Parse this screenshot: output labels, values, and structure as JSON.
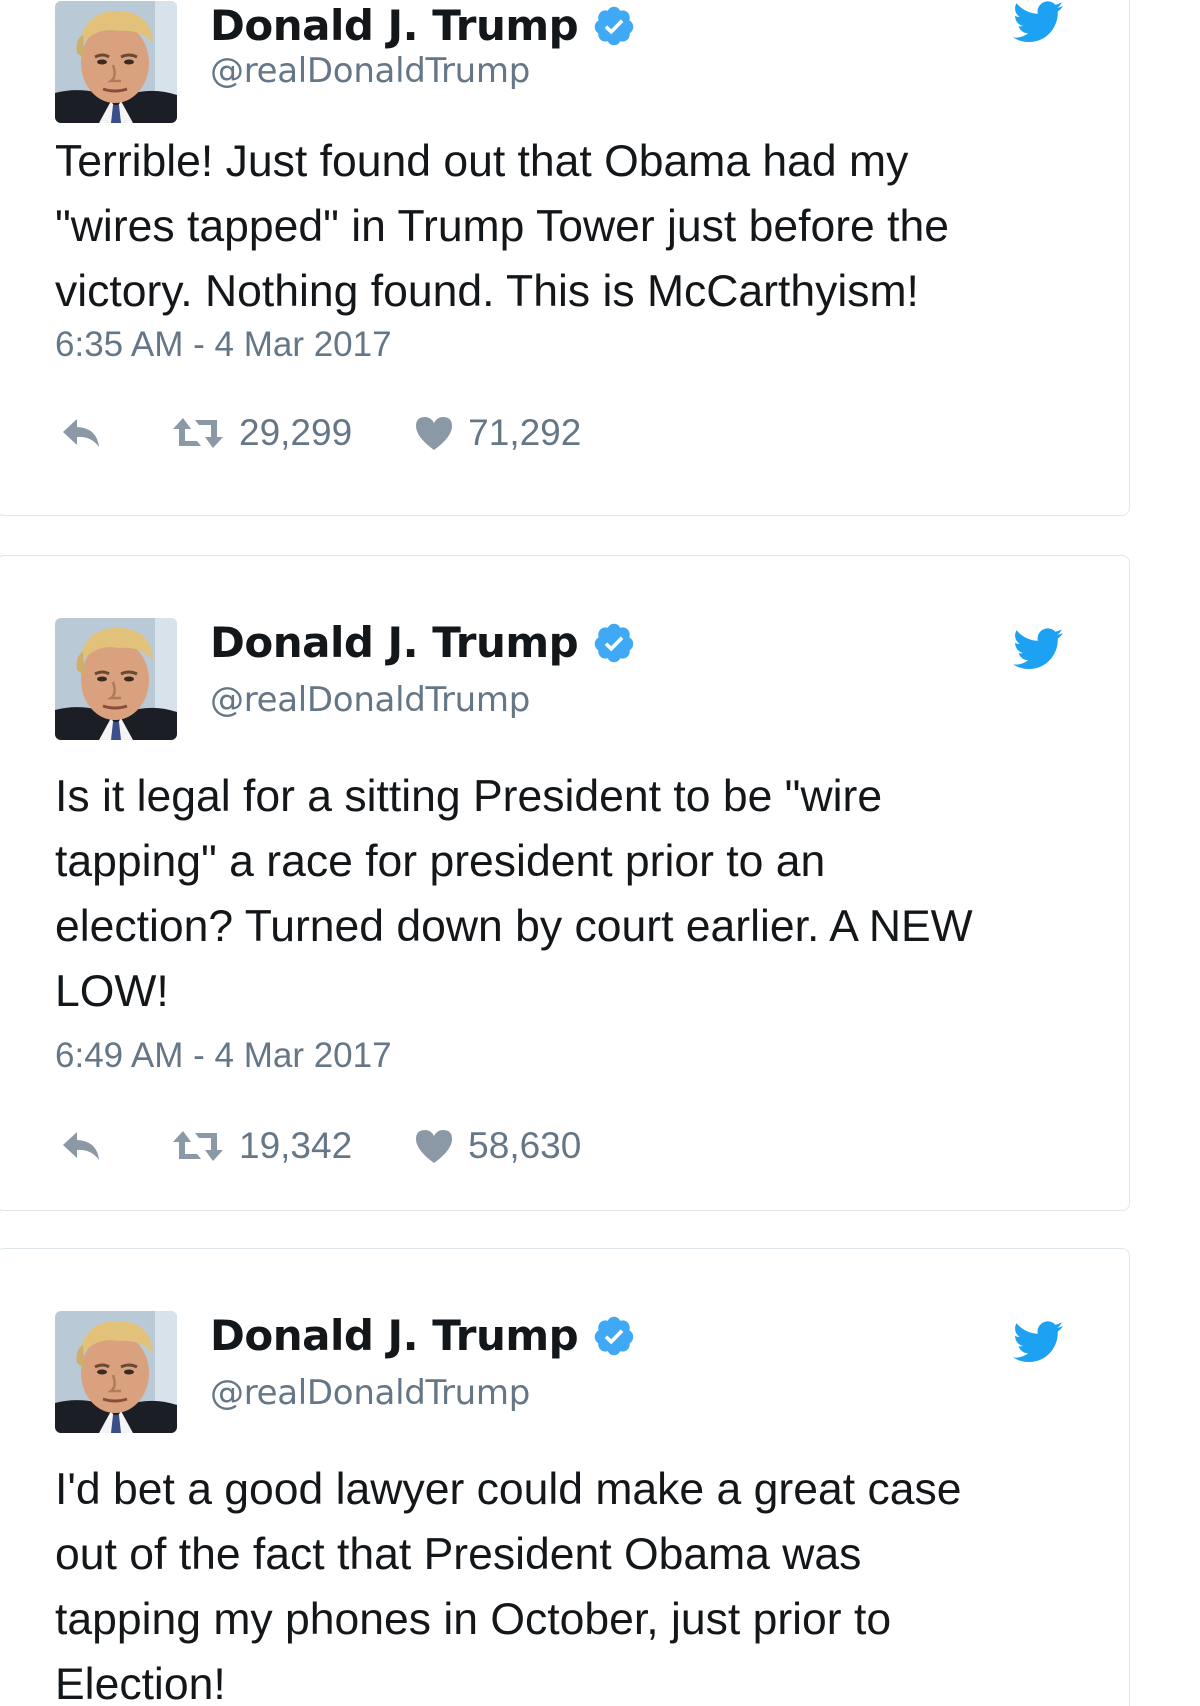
{
  "tweets": [
    {
      "name": "Donald J. Trump",
      "handle": "@realDonaldTrump",
      "text": "Terrible! Just found out that Obama had my\n\"wires tapped\" in Trump Tower just before the\nvictory. Nothing found. This is McCarthyism!",
      "timestamp": "6:35 AM - 4 Mar 2017",
      "retweets": "29,299",
      "likes": "71,292"
    },
    {
      "name": "Donald J. Trump",
      "handle": "@realDonaldTrump",
      "text": "Is it legal for a sitting President to be \"wire\ntapping\" a race for president prior to an\nelection? Turned down by court earlier. A NEW\nLOW!",
      "timestamp": "6:49 AM - 4 Mar 2017",
      "retweets": "19,342",
      "likes": "58,630"
    },
    {
      "name": "Donald J. Trump",
      "handle": "@realDonaldTrump",
      "text": "I'd bet a good lawyer could make a great case\nout of the fact that President Obama was\ntapping my phones in October, just prior to\nElection!"
    }
  ],
  "icons": {
    "verified": "verified-badge-icon",
    "twitter": "twitter-bird-icon",
    "reply": "reply-icon",
    "retweet": "retweet-icon",
    "like": "heart-icon"
  },
  "colors": {
    "twitter_blue": "#1da1f2",
    "verified_blue": "#3fa9f5",
    "secondary_text": "#657786",
    "primary_text": "#14171a",
    "border": "#e1e8ed"
  }
}
